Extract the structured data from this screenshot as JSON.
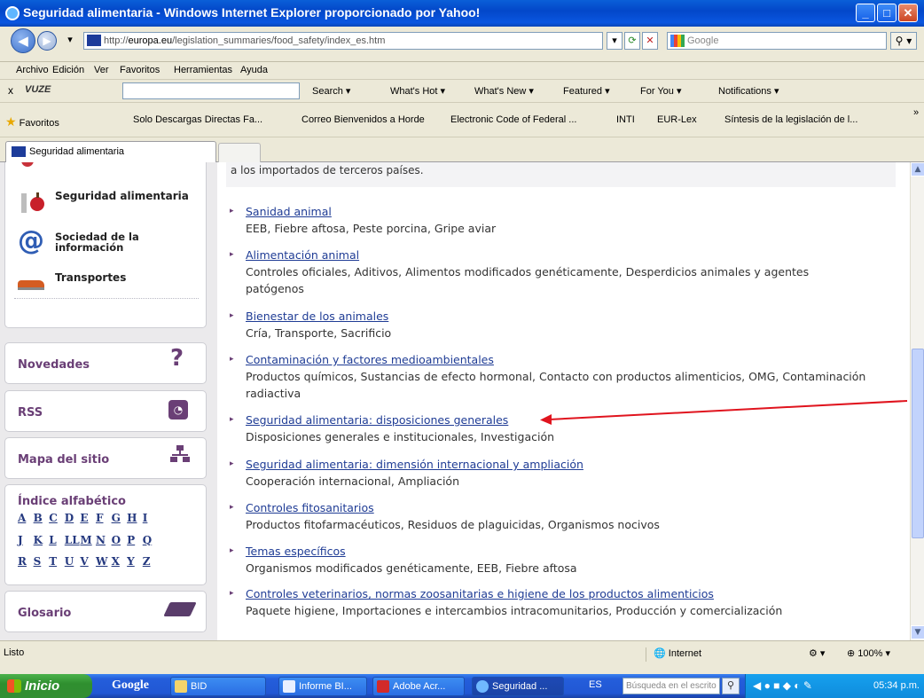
{
  "window": {
    "title": "Seguridad alimentaria - Windows Internet Explorer proporcionado por Yahoo!"
  },
  "address": {
    "url_prefix": "http://",
    "url_host": "europa.eu",
    "url_path": "/legislation_summaries/food_safety/index_es.htm",
    "search_placeholder": "Google"
  },
  "menu": [
    "Archivo",
    "Edición",
    "Ver",
    "Favoritos",
    "Herramientas",
    "Ayuda"
  ],
  "vuze": {
    "logo": "VUZE",
    "items": [
      "Search ▾",
      "What's Hot ▾",
      "What's New ▾",
      "Featured ▾",
      "For You ▾",
      "Notifications ▾"
    ]
  },
  "favorites": {
    "label": "Favoritos",
    "items": [
      "Solo Descargas Directas Fa...",
      "Correo  Bienvenidos a Horde",
      "Electronic Code of Federal ...",
      "INTI",
      "EUR-Lex",
      "Síntesis de la legislación de l..."
    ]
  },
  "tab": {
    "label": "Seguridad alimentaria"
  },
  "sidebar": {
    "categories": [
      {
        "label": "Seguridad alimentaria",
        "icon": "apple-icon"
      },
      {
        "label": "Sociedad de la información",
        "line1": "Sociedad de la",
        "line2": "información",
        "icon": "at-sign-icon"
      },
      {
        "label": "Transportes",
        "icon": "train-icon"
      }
    ],
    "novedades": "Novedades",
    "rss": "RSS",
    "mapa": "Mapa del sitio",
    "indice": "Índice alfabético",
    "letters_row1": [
      "A",
      "B",
      "C",
      "D",
      "E",
      "F",
      "G",
      "H",
      "I"
    ],
    "letters_row2": [
      "J",
      "K",
      "L",
      "LL",
      "M",
      "N",
      "O",
      "P",
      "Q"
    ],
    "letters_row3": [
      "R",
      "S",
      "T",
      "U",
      "V",
      "W",
      "X",
      "Y",
      "Z"
    ],
    "glosario": "Glosario"
  },
  "main": {
    "intro": "a los importados de terceros países.",
    "items": [
      {
        "title": "Sanidad animal",
        "desc": "EEB, Fiebre aftosa, Peste porcina, Gripe aviar"
      },
      {
        "title": "Alimentación animal",
        "desc": "Controles oficiales, Aditivos, Alimentos modificados genéticamente, Desperdicios animales y agentes patógenos"
      },
      {
        "title": "Bienestar de los animales",
        "desc": "Cría, Transporte, Sacrificio"
      },
      {
        "title": "Contaminación y factores medioambientales",
        "desc": "Productos químicos, Sustancias de efecto hormonal, Contacto con productos alimenticios, OMG, Contaminación radiactiva"
      },
      {
        "title": "Seguridad alimentaria: disposiciones generales",
        "desc": "Disposiciones generales e institucionales, Investigación"
      },
      {
        "title": "Seguridad alimentaria: dimensión internacional y ampliación",
        "desc": "Cooperación internacional, Ampliación"
      },
      {
        "title": "Controles fitosanitarios",
        "desc": "Productos fitofarmacéuticos, Residuos de plaguicidas, Organismos nocivos"
      },
      {
        "title": "Temas específicos",
        "desc": "Organismos modificados genéticamente, EEB, Fiebre aftosa"
      },
      {
        "title": "Controles veterinarios, normas zoosanitarias e higiene de los productos alimenticios",
        "desc": "Paquete higiene, Importaciones e intercambios intracomunitarios, Producción y comercialización"
      }
    ]
  },
  "status": {
    "text": "Listo",
    "zone": "Internet",
    "zoom": "100%"
  },
  "taskbar": {
    "start": "Inicio",
    "google": "Google",
    "buttons": [
      "BID",
      "Informe BI...",
      "Adobe Acr...",
      "Seguridad ..."
    ],
    "lang": "ES",
    "search_placeholder": "Búsqueda en el escrito",
    "clock": "05:34 p.m."
  },
  "colors": {
    "annotation_arrow": "#e0141e",
    "link": "#1f3c95",
    "sidebar_link": "#6a3f76"
  }
}
